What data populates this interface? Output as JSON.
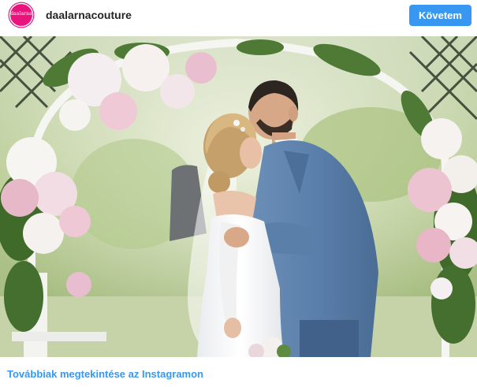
{
  "header": {
    "avatar_text": "daalarna",
    "username": "daalarnacouture",
    "follow_label": "Követem"
  },
  "photo": {
    "subject": "wedding-kiss-under-floral-arch"
  },
  "footer": {
    "link_label": "Továbbiak megtekintése az Instagramon"
  },
  "colors": {
    "accent": "#3897f0",
    "avatar": "#e8147c",
    "username": "#262626"
  }
}
